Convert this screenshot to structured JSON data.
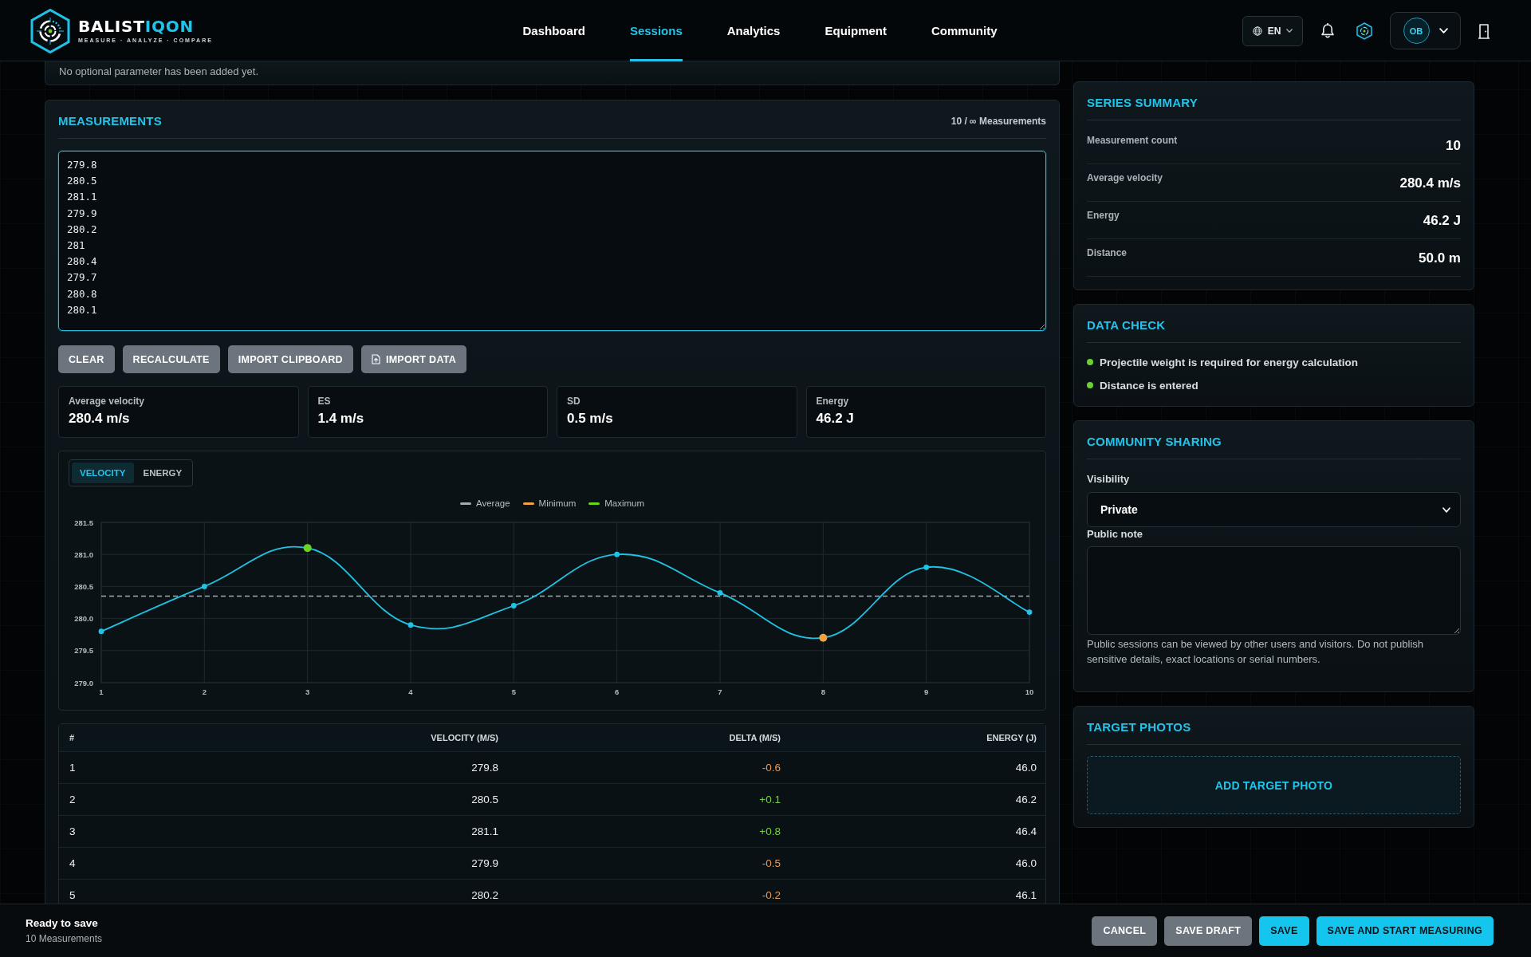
{
  "header": {
    "brand": {
      "name_parts": [
        {
          "text": "BALIST",
          "kind": "plain"
        },
        {
          "text": "IQON",
          "kind": "accent"
        }
      ],
      "tagline": "MEASURE · ANALYZE · COMPARE"
    },
    "nav": [
      {
        "label": "Dashboard",
        "selected": false
      },
      {
        "label": "Sessions",
        "selected": true
      },
      {
        "label": "Analytics",
        "selected": false
      },
      {
        "label": "Equipment",
        "selected": false
      },
      {
        "label": "Community",
        "selected": false
      }
    ],
    "language": "EN",
    "user": {
      "initials": "OB"
    }
  },
  "optional_parameters": {
    "empty_text": "No optional parameter has been added yet."
  },
  "measurements": {
    "title": "MEASUREMENTS",
    "count_label": "10 / ∞ Measurements",
    "values": [
      "279.8",
      "280.5",
      "281.1",
      "279.9",
      "280.2",
      "281",
      "280.4",
      "279.7",
      "280.8",
      "280.1"
    ],
    "actions": [
      {
        "label": "CLEAR",
        "kind": "plain"
      },
      {
        "label": "RECALCULATE",
        "kind": "plain"
      },
      {
        "label": "IMPORT CLIPBOARD",
        "kind": "plain"
      },
      {
        "label": "IMPORT DATA",
        "kind": "file"
      }
    ],
    "stats": [
      {
        "label": "Average velocity",
        "value": "280.4 m/s"
      },
      {
        "label": "ES",
        "value": "1.4 m/s"
      },
      {
        "label": "SD",
        "value": "0.5 m/s"
      },
      {
        "label": "Energy",
        "value": "46.2 J"
      }
    ],
    "chart": {
      "tabs": [
        {
          "label": "VELOCITY",
          "selected": true
        },
        {
          "label": "ENERGY",
          "selected": false
        }
      ],
      "legend": [
        {
          "label": "Average",
          "kind": "average",
          "color": "#a3abb3"
        },
        {
          "label": "Minimum",
          "kind": "minimum",
          "color": "#f2a341"
        },
        {
          "label": "Maximum",
          "kind": "maximum",
          "color": "#6ad41c"
        }
      ],
      "chart_data": {
        "type": "line",
        "x": [
          1,
          2,
          3,
          4,
          5,
          6,
          7,
          8,
          9,
          10
        ],
        "series": [
          {
            "color": "#1fc3e3",
            "marker": "circle",
            "values": [
              279.8,
              280.5,
              281.1,
              279.9,
              280.2,
              281.0,
              280.4,
              279.7,
              280.8,
              280.1
            ]
          }
        ],
        "xlim": [
          1,
          10
        ],
        "ylim": [
          279.0,
          281.5
        ],
        "xticks": [
          1,
          2,
          3,
          4,
          5,
          6,
          7,
          8,
          9,
          10
        ],
        "yticks": [
          {
            "value": 279.0,
            "label": "279.0"
          },
          {
            "value": 279.5,
            "label": "279.5"
          },
          {
            "value": 280.0,
            "label": "280.0"
          },
          {
            "value": 280.5,
            "label": "280.5"
          },
          {
            "value": 281.0,
            "label": "281.0"
          },
          {
            "value": 281.5,
            "label": "281.5"
          }
        ],
        "grid": true,
        "ref_lines": [
          {
            "axis": "y",
            "value": 280.35,
            "color": "#a3abb3"
          }
        ]
      }
    },
    "table": {
      "columns": [
        "#",
        "VELOCITY (M/S)",
        "DELTA (M/S)",
        "ENERGY (J)"
      ],
      "rows": [
        {
          "index": "1",
          "velocity": "279.8",
          "delta": "-0.6",
          "energy": "46.0",
          "color": "#e99a55"
        },
        {
          "index": "2",
          "velocity": "280.5",
          "delta": "+0.1",
          "energy": "46.2",
          "color": "#72d33c"
        },
        {
          "index": "3",
          "velocity": "281.1",
          "delta": "+0.8",
          "energy": "46.4",
          "color": "#72d33c"
        },
        {
          "index": "4",
          "velocity": "279.9",
          "delta": "-0.5",
          "energy": "46.0",
          "color": "#e99a55"
        },
        {
          "index": "5",
          "velocity": "280.2",
          "delta": "-0.2",
          "energy": "46.1",
          "color": "#e99a55"
        }
      ]
    }
  },
  "series_summary": {
    "title": "SERIES SUMMARY",
    "rows": [
      {
        "label": "Measurement count",
        "value": "10"
      },
      {
        "label": "Average velocity",
        "value": "280.4 m/s"
      },
      {
        "label": "Energy",
        "value": "46.2 J"
      },
      {
        "label": "Distance",
        "value": "50.0 m"
      }
    ]
  },
  "data_check": {
    "title": "DATA CHECK",
    "items": [
      {
        "text": "Projectile weight is required for energy calculation",
        "color": "#6cd033"
      },
      {
        "text": "Distance is entered",
        "color": "#6cd033"
      }
    ]
  },
  "community_sharing": {
    "title": "COMMUNITY SHARING",
    "visibility_label": "Visibility",
    "visibility_value": "Private",
    "note_label": "Public note",
    "help_text": "Public sessions can be viewed by other users and visitors. Do not publish sensitive details, exact locations or serial numbers."
  },
  "target_photos": {
    "title": "TARGET PHOTOS",
    "add_label": "ADD TARGET PHOTO"
  },
  "footer": {
    "status": "Ready to save",
    "detail": "10 Measurements",
    "actions": [
      {
        "label": "CANCEL",
        "kind": "secondary"
      },
      {
        "label": "SAVE DRAFT",
        "kind": "secondary"
      },
      {
        "label": "SAVE",
        "kind": "primary"
      },
      {
        "label": "SAVE AND START MEASURING",
        "kind": "primary"
      }
    ]
  }
}
